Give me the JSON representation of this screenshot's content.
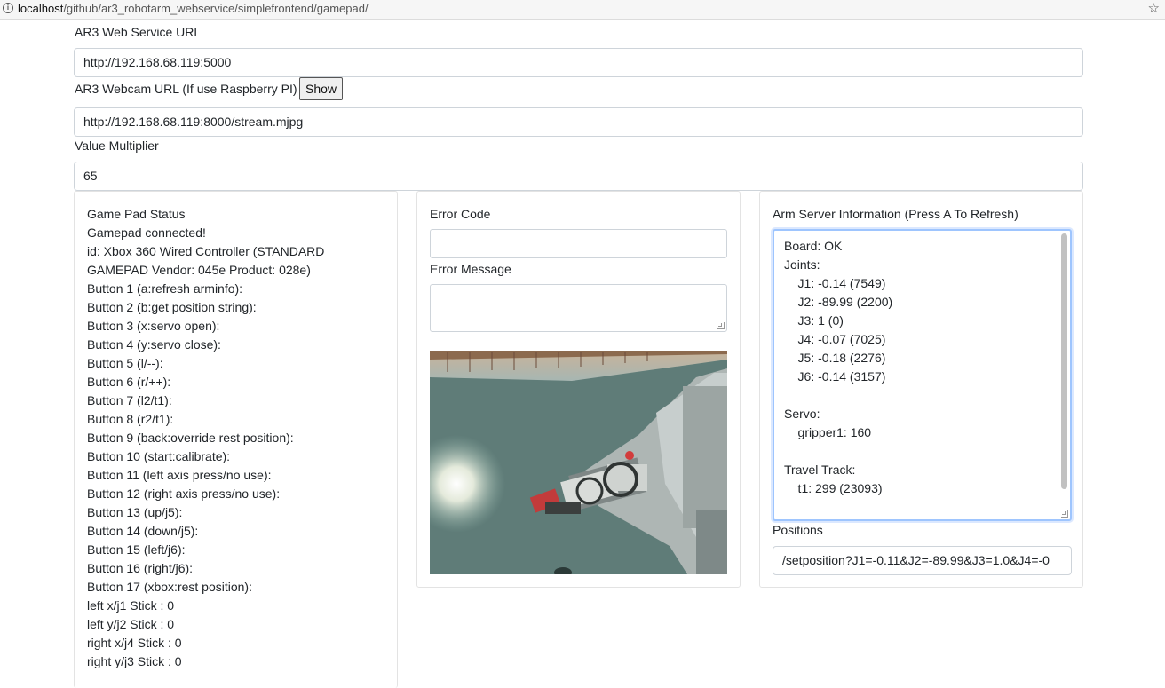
{
  "browser": {
    "url_host": "localhost",
    "url_path": "/github/ar3_robotarm_webservice/simplefrontend/gamepad/"
  },
  "settings": {
    "web_service_label": "AR3 Web Service URL",
    "web_service_value": "http://192.168.68.119:5000",
    "webcam_label": "AR3 Webcam URL (If use Raspberry PI)",
    "show_button": "Show",
    "webcam_value": "http://192.168.68.119:8000/stream.mjpg",
    "multiplier_label": "Value Multiplier",
    "multiplier_value": "65"
  },
  "gamepad": {
    "lines": [
      "Game Pad Status",
      "Gamepad connected!",
      "id: Xbox 360 Wired Controller (STANDARD",
      "GAMEPAD Vendor: 045e Product: 028e)",
      "Button 1 (a:refresh arminfo):",
      "Button 2 (b:get position string):",
      "Button 3 (x:servo open):",
      "Button 4 (y:servo close):",
      "Button 5 (l/--):",
      "Button 6 (r/++):",
      "Button 7 (l2/t1):",
      "Button 8 (r2/t1):",
      "Button 9 (back:override rest position):",
      "Button 10 (start:calibrate):",
      "Button 11 (left axis press/no use):",
      "Button 12 (right axis press/no use):",
      "Button 13 (up/j5):",
      "Button 14 (down/j5):",
      "Button 15 (left/j6):",
      "Button 16 (right/j6):",
      "Button 17 (xbox:rest position):",
      "left x/j1 Stick : 0",
      "left y/j2 Stick : 0",
      "right x/j4 Stick : 0",
      "right y/j3 Stick : 0"
    ]
  },
  "error": {
    "code_label": "Error Code",
    "code_value": "",
    "message_label": "Error Message",
    "message_value": ""
  },
  "arm": {
    "title": "Arm Server Information (Press A To Refresh)",
    "lines": [
      "Board: OK",
      "Joints:",
      "    J1: -0.14 (7549)",
      "    J2: -89.99 (2200)",
      "    J3: 1 (0)",
      "    J4: -0.07 (7025)",
      "    J5: -0.18 (2276)",
      "    J6: -0.14 (3157)",
      "",
      "Servo:",
      "    gripper1: 160",
      "",
      "Travel Track:",
      "    t1: 299 (23093)"
    ],
    "positions_label": "Positions",
    "positions_value": "/setposition?J1=-0.11&J2=-89.99&J3=1.0&J4=-0"
  }
}
